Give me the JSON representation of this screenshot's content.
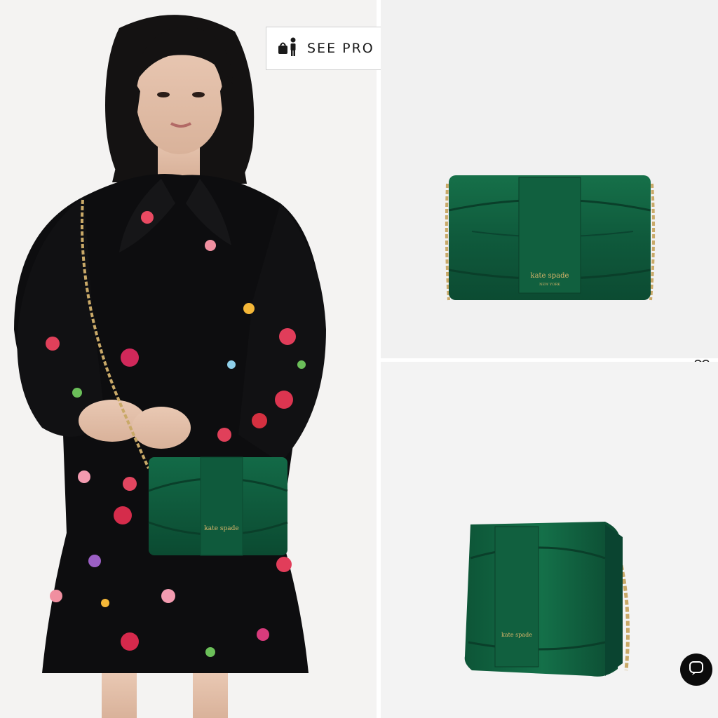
{
  "see_products": {
    "label": "SEE PRO",
    "icon": "bag-person-icon"
  },
  "product": {
    "brand": "kate spade",
    "brand_sub": "NEW YORK",
    "color": "#0f5a3c"
  },
  "colors": {
    "bag_green": "#0f5a3c",
    "dress_black": "#0d0d0f",
    "chain_gold": "#c9a968",
    "chat_button": "#0b0b0b"
  },
  "icons": {
    "wishlist": "heart-icon",
    "chat": "chat-bubble-icon"
  }
}
